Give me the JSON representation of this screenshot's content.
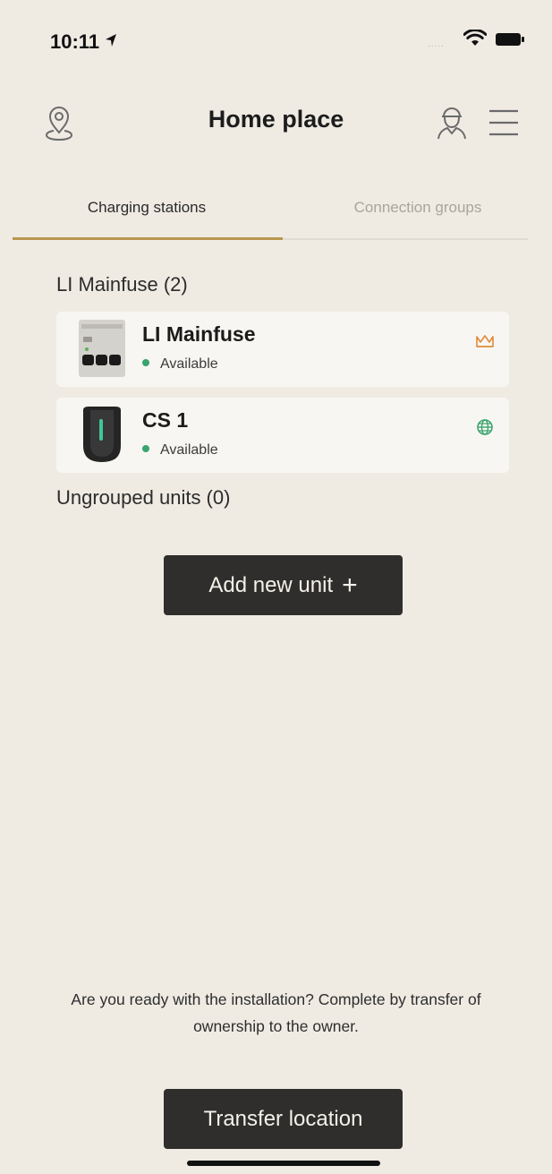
{
  "status_bar": {
    "time": "10:11",
    "signal": "....."
  },
  "header": {
    "title": "Home place"
  },
  "tabs": [
    {
      "label": "Charging stations",
      "active": true
    },
    {
      "label": "Connection groups",
      "active": false
    }
  ],
  "groups": [
    {
      "title": "LI Mainfuse (2)",
      "units": [
        {
          "name": "LI Mainfuse",
          "status": "Available",
          "badge_icon": "crown-icon",
          "badge_color": "#e08a3c",
          "status_color": "#3aa46d"
        },
        {
          "name": "CS 1",
          "status": "Available",
          "badge_icon": "globe-icon",
          "badge_color": "#3aa46d",
          "status_color": "#3aa46d"
        }
      ]
    }
  ],
  "ungrouped": {
    "title": "Ungrouped units (0)"
  },
  "add_unit_button": {
    "label": "Add new unit",
    "icon": "plus-icon"
  },
  "install_note": "Are you ready with the installation? Complete by transfer of ownership to the owner.",
  "transfer_button": {
    "label": "Transfer location"
  },
  "colors": {
    "background": "#efebe3",
    "accent": "#b8974f",
    "button": "#2f2e2c",
    "available": "#3aa46d"
  }
}
